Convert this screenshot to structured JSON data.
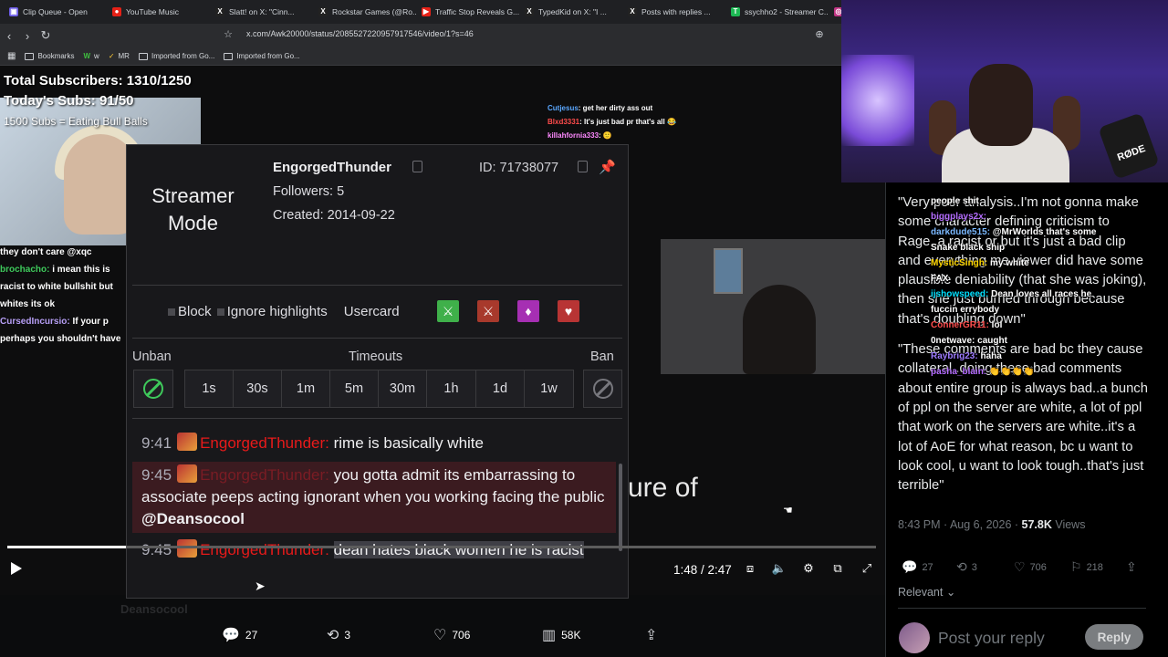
{
  "browser": {
    "tabs": [
      {
        "label": "Clip Queue - Open",
        "color": "#6c5ce7",
        "glyph": "▣"
      },
      {
        "label": "YouTube Music",
        "color": "#e62117",
        "glyph": "●"
      },
      {
        "label": "Slatt! on X: \"Cinn...",
        "color": "#222",
        "glyph": "X"
      },
      {
        "label": "Rockstar Games (@Ro...",
        "color": "#222",
        "glyph": "X"
      },
      {
        "label": "Traffic Stop Reveals G...",
        "color": "#e62117",
        "glyph": "▶"
      },
      {
        "label": "TypedKid on X: \"I ...",
        "color": "#222",
        "glyph": "X"
      },
      {
        "label": "Posts with replies ...",
        "color": "#222",
        "glyph": "X"
      },
      {
        "label": "ssychho2 - Streamer C...",
        "color": "#1db954",
        "glyph": "T"
      },
      {
        "label": "",
        "color": "#c13584",
        "glyph": "◎"
      }
    ],
    "url": "x.com/Awk20000/status/2085527220957917546/video/1?s=46",
    "bookmarks": [
      "Bookmarks",
      "w",
      "MR",
      "Imported from Go...",
      "Imported from Go..."
    ]
  },
  "stream": {
    "sub_counter": "Total Subscribers: 1310/1250",
    "today_subs": "Today's Subs: 91/50",
    "sub_goal": "1500 Subs = Eating Bull Balls",
    "left_chat": [
      {
        "user": "",
        "text": "they don't care @xqc"
      },
      {
        "user": "brochacho:",
        "text": " i mean this is racist to white bullshit but whites its ok"
      },
      {
        "user": "CursedIncursio:",
        "text": " If your p perhaps you shouldn't have"
      }
    ],
    "top_chat": [
      {
        "user": "Cutjesus",
        "text": ": get her dirty ass out"
      },
      {
        "user": "Blxd3331",
        "text": ": It's just bad pr that's all 😂"
      },
      {
        "user": "killahfornia333",
        "text": ": 🙂"
      }
    ],
    "subtitle": "ure of"
  },
  "usercard": {
    "mode": "Streamer Mode",
    "username": "EngorgedThunder",
    "followers": "Followers: 5",
    "created": "Created: 2014-09-22",
    "id": "ID: 71738077",
    "actions": {
      "block": "Block",
      "ignore": "Ignore highlights",
      "usercard": "Usercard"
    },
    "badges": [
      {
        "name": "green",
        "color": "#3fb04a"
      },
      {
        "name": "red",
        "color": "#a8392c"
      },
      {
        "name": "purple",
        "color": "#a62fb3"
      },
      {
        "name": "red-heart",
        "color": "#b83434"
      }
    ],
    "labels": {
      "unban": "Unban",
      "timeouts": "Timeouts",
      "ban": "Ban"
    },
    "timeouts": [
      "1s",
      "30s",
      "1m",
      "5m",
      "30m",
      "1h",
      "1d",
      "1w"
    ],
    "messages": [
      {
        "time": "9:41",
        "user": "EngorgedThunder:",
        "text": " rime is basically white"
      },
      {
        "time": "9:45",
        "user": "EngorgedThunder:",
        "text": " you gotta admit its embarrassing to associate peeps acting ignorant when you working facing the public ",
        "mention": "@Deansocool"
      },
      {
        "time": "9:45",
        "user": "EngorgedThunder:",
        "text": "dean hates black women he is racist"
      }
    ]
  },
  "video": {
    "time": "1:48 / 2:47",
    "progress": 0.137
  },
  "tweet_bottom": {
    "replies": "27",
    "reposts": "3",
    "likes": "706",
    "views": "58K",
    "author": "Deansocool"
  },
  "right": {
    "reply_paragraphs": [
      "\"Very poor analysis..I'm not gonna make some character defining criticism to Rage..a racist or but it's just a bad clip and everything me viewer did have some plausible deniability (that she was joking), then she just burned through because that's doubling down\"",
      "\"These comments are bad bc they cause collateral..doing these bad comments about entire group is always bad..a bunch of ppl on the server are white, a lot of ppl that work on the servers are white..it's a lot of AoE for what reason, bc u want to look cool, u want to look tough..that's just terrible\""
    ],
    "overlay_chat": [
      {
        "user": "",
        "text": "people shit",
        "cls": ""
      },
      {
        "user": "biggplays2x:",
        "text": "",
        "cls": "c1"
      },
      {
        "user": "darkdude515:",
        "text": " @MrWorlds that's some",
        "cls": "c3"
      },
      {
        "user": "",
        "text": "Snake black ship",
        "cls": ""
      },
      {
        "user": "MysticSingh:",
        "text": " my white",
        "cls": "c5"
      },
      {
        "user": "",
        "text": "FAX",
        "cls": ""
      },
      {
        "user": "ijshowspeed:",
        "text": " Dean loves all races he",
        "cls": "c6"
      },
      {
        "user": "",
        "text": "fuccin errybody",
        "cls": ""
      },
      {
        "user": "ConnerGR11:",
        "text": " lol",
        "cls": "c4"
      },
      {
        "user": "0netwave:",
        "text": " caught",
        "cls": ""
      },
      {
        "user": "Raybrig23:",
        "text": " haha",
        "cls": "c2"
      },
      {
        "user": "pasha_blain:",
        "text": " 👏👏👏👏",
        "cls": "c1"
      }
    ],
    "date": "8:43 PM · Aug 6, 2026 · ",
    "views_count": "57.8K",
    "views_label": " Views",
    "stats": {
      "replies": "27",
      "reposts": "3",
      "likes": "706",
      "bookmarks": "218"
    },
    "relevant": "Relevant",
    "reply_placeholder": "Post your reply",
    "reply_button": "Reply",
    "rode": "RØDE"
  }
}
